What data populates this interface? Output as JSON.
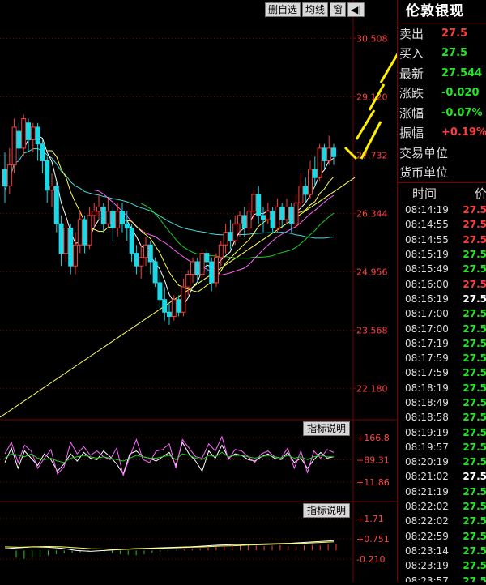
{
  "toolbar": {
    "buttons": [
      "删自选",
      "均线",
      "窗"
    ],
    "arrow_label": "◀|"
  },
  "price_axis": {
    "labels": [
      "30.508",
      "29.120",
      "27.732",
      "26.344",
      "24.956",
      "23.568",
      "22.180"
    ]
  },
  "indicator1": {
    "button": "指标说明",
    "labels": [
      "+166.8",
      "+89.31",
      "+11.86"
    ]
  },
  "indicator2": {
    "button": "指标说明",
    "labels": [
      "+1.71",
      "+0.751",
      "-0.210"
    ]
  },
  "panel": {
    "title": "伦敦银现",
    "quotes": [
      {
        "label": "卖出",
        "value": "27.5",
        "color": "#ff3b3b"
      },
      {
        "label": "买入",
        "value": "27.5",
        "color": "#22e622"
      },
      {
        "label": "最新",
        "value": "27.544",
        "color": "#22e622"
      },
      {
        "label": "涨跌",
        "value": "-0.020",
        "color": "#22e622"
      },
      {
        "label": "涨幅",
        "value": "-0.07%",
        "color": "#22e622"
      },
      {
        "label": "振幅",
        "value": "+0.19%",
        "color": "#ff3b3b"
      },
      {
        "label": "交易单位",
        "value": "",
        "color": "#ddd"
      },
      {
        "label": "货币单位",
        "value": "",
        "color": "#ddd"
      }
    ],
    "ticks_header": {
      "time": "时间",
      "price": "价"
    },
    "ticks": [
      {
        "time": "08:14:19",
        "price": "27.5",
        "color": "#ff3b3b"
      },
      {
        "time": "08:14:55",
        "price": "27.5",
        "color": "#ff3b3b"
      },
      {
        "time": "08:14:55",
        "price": "27.5",
        "color": "#ff3b3b"
      },
      {
        "time": "08:15:19",
        "price": "27.5",
        "color": "#22e622"
      },
      {
        "time": "08:15:49",
        "price": "27.5",
        "color": "#22e622"
      },
      {
        "time": "08:16:00",
        "price": "27.5",
        "color": "#ff3b3b"
      },
      {
        "time": "08:16:19",
        "price": "27.5",
        "color": "#ffffff"
      },
      {
        "time": "08:17:00",
        "price": "27.5",
        "color": "#22e622"
      },
      {
        "time": "08:17:00",
        "price": "27.5",
        "color": "#22e622"
      },
      {
        "time": "08:17:19",
        "price": "27.5",
        "color": "#22e622"
      },
      {
        "time": "08:17:59",
        "price": "27.5",
        "color": "#22e622"
      },
      {
        "time": "08:17:59",
        "price": "27.5",
        "color": "#22e622"
      },
      {
        "time": "08:18:19",
        "price": "27.5",
        "color": "#22e622"
      },
      {
        "time": "08:18:49",
        "price": "27.5",
        "color": "#22e622"
      },
      {
        "time": "08:18:58",
        "price": "27.5",
        "color": "#22e622"
      },
      {
        "time": "08:19:19",
        "price": "27.5",
        "color": "#22e622"
      },
      {
        "time": "08:19:57",
        "price": "27.5",
        "color": "#22e622"
      },
      {
        "time": "08:20:19",
        "price": "27.5",
        "color": "#22e622"
      },
      {
        "time": "08:21:02",
        "price": "27.5",
        "color": "#ffffff"
      },
      {
        "time": "08:21:19",
        "price": "27.5",
        "color": "#22e622"
      },
      {
        "time": "08:22:02",
        "price": "27.5",
        "color": "#22e622"
      },
      {
        "time": "08:22:02",
        "price": "27.5",
        "color": "#22e622"
      },
      {
        "time": "08:22:59",
        "price": "27.5",
        "color": "#22e622"
      },
      {
        "time": "08:23:14",
        "price": "27.5",
        "color": "#22e622"
      },
      {
        "time": "08:23:19",
        "price": "27.5",
        "color": "#22e622"
      },
      {
        "time": "08:23:57",
        "price": "27.5",
        "color": "#22e622"
      }
    ]
  },
  "chart_data": {
    "type": "candlestick",
    "ylim": [
      21.5,
      31.0
    ],
    "colors": {
      "up": "#ff3b3b",
      "down": "#19d9e6",
      "ma5": "#ffffff",
      "ma10": "#ffff55",
      "ma20": "#ff66ff",
      "ma30": "#22cc22",
      "ma60": "#44dddd",
      "trend": "#ffff66",
      "axis": "#7a0000"
    },
    "candles": [
      [
        27.4,
        27.0,
        27.8,
        26.6
      ],
      [
        27.0,
        27.5,
        27.9,
        26.8
      ],
      [
        27.5,
        28.4,
        28.6,
        27.3
      ],
      [
        28.3,
        27.9,
        28.5,
        27.6
      ],
      [
        27.9,
        28.6,
        28.7,
        27.7
      ],
      [
        28.5,
        28.1,
        28.6,
        27.8
      ],
      [
        28.1,
        28.4,
        28.5,
        27.8
      ],
      [
        28.4,
        28.0,
        28.5,
        27.6
      ],
      [
        28.0,
        27.6,
        28.1,
        27.3
      ],
      [
        27.6,
        26.9,
        27.7,
        26.6
      ],
      [
        26.9,
        27.0,
        27.3,
        26.5
      ],
      [
        27.0,
        26.1,
        27.1,
        25.9
      ],
      [
        26.1,
        25.4,
        26.3,
        25.1
      ],
      [
        25.4,
        26.0,
        26.2,
        25.2
      ],
      [
        26.0,
        25.1,
        26.1,
        24.9
      ],
      [
        25.1,
        25.6,
        25.9,
        24.9
      ],
      [
        25.6,
        26.2,
        26.4,
        25.4
      ],
      [
        26.2,
        25.6,
        26.3,
        25.4
      ],
      [
        25.6,
        26.3,
        26.5,
        25.5
      ],
      [
        26.3,
        26.4,
        26.6,
        26.0
      ],
      [
        26.4,
        26.5,
        26.8,
        26.2
      ],
      [
        26.5,
        26.1,
        26.6,
        25.9
      ],
      [
        26.1,
        26.4,
        26.7,
        26.0
      ],
      [
        26.4,
        26.0,
        26.5,
        25.7
      ],
      [
        26.0,
        26.4,
        26.6,
        25.8
      ],
      [
        26.4,
        26.1,
        26.6,
        25.9
      ],
      [
        26.1,
        26.0,
        26.4,
        25.7
      ],
      [
        26.0,
        25.4,
        26.1,
        25.2
      ],
      [
        25.4,
        25.1,
        25.6,
        24.9
      ],
      [
        25.1,
        25.3,
        25.6,
        24.8
      ],
      [
        25.3,
        25.6,
        25.8,
        25.1
      ],
      [
        25.6,
        25.2,
        25.7,
        24.9
      ],
      [
        25.2,
        24.7,
        25.3,
        24.6
      ],
      [
        24.7,
        24.3,
        24.9,
        24.1
      ],
      [
        24.3,
        24.0,
        24.6,
        23.8
      ],
      [
        24.0,
        23.9,
        24.2,
        23.7
      ],
      [
        23.9,
        24.3,
        24.4,
        23.8
      ],
      [
        24.3,
        24.0,
        24.4,
        23.9
      ],
      [
        24.0,
        24.6,
        24.8,
        23.9
      ],
      [
        24.6,
        24.9,
        25.0,
        24.4
      ],
      [
        24.9,
        25.2,
        25.3,
        24.7
      ],
      [
        25.2,
        24.9,
        25.3,
        24.7
      ],
      [
        24.9,
        25.4,
        25.5,
        24.8
      ],
      [
        25.4,
        25.2,
        25.5,
        24.9
      ],
      [
        25.2,
        24.7,
        25.3,
        24.5
      ],
      [
        24.7,
        25.3,
        25.4,
        24.6
      ],
      [
        25.3,
        25.6,
        25.7,
        25.1
      ],
      [
        25.6,
        25.9,
        26.1,
        25.4
      ],
      [
        25.9,
        25.7,
        26.2,
        25.5
      ],
      [
        25.7,
        26.1,
        26.3,
        25.6
      ],
      [
        26.1,
        26.3,
        26.4,
        25.8
      ],
      [
        26.3,
        26.0,
        26.5,
        25.8
      ],
      [
        26.0,
        26.4,
        26.6,
        25.8
      ],
      [
        26.4,
        26.8,
        26.9,
        26.2
      ],
      [
        26.8,
        26.3,
        27.0,
        26.1
      ],
      [
        26.3,
        26.2,
        26.5,
        25.9
      ],
      [
        26.2,
        26.4,
        26.6,
        26.1
      ],
      [
        26.4,
        26.0,
        26.5,
        25.9
      ],
      [
        26.0,
        26.5,
        26.7,
        25.9
      ],
      [
        26.5,
        26.2,
        26.6,
        26.0
      ],
      [
        26.2,
        26.5,
        26.7,
        26.1
      ],
      [
        26.5,
        26.1,
        26.6,
        25.9
      ],
      [
        26.1,
        26.6,
        26.8,
        26.0
      ],
      [
        26.6,
        27.0,
        27.3,
        26.5
      ],
      [
        27.0,
        26.8,
        27.2,
        26.6
      ],
      [
        26.8,
        27.4,
        27.6,
        26.7
      ],
      [
        27.4,
        27.2,
        27.7,
        27.0
      ],
      [
        27.2,
        27.9,
        28.0,
        27.1
      ],
      [
        27.9,
        27.6,
        28.0,
        27.4
      ],
      [
        27.6,
        27.9,
        28.2,
        27.5
      ],
      [
        27.9,
        27.7,
        28.0,
        27.5
      ]
    ],
    "indicator1_series": [
      {
        "name": "k",
        "color": "#ffffff",
        "values": [
          80,
          130,
          60,
          120,
          95,
          70,
          110,
          90,
          50,
          75,
          110,
          85,
          115,
          95,
          90,
          120,
          100,
          75,
          40,
          110,
          120,
          100,
          95,
          85,
          100,
          115,
          70,
          150,
          110,
          85,
          50,
          120,
          95,
          140,
          95,
          110,
          105,
          90,
          85,
          100,
          110,
          95,
          90,
          115,
          80,
          95,
          60,
          90,
          115,
          95,
          100
        ]
      },
      {
        "name": "d",
        "color": "#ff66ff",
        "values": [
          110,
          150,
          80,
          140,
          120,
          60,
          95,
          125,
          40,
          65,
          150,
          110,
          135,
          105,
          120,
          100,
          90,
          130,
          35,
          100,
          160,
          90,
          80,
          120,
          125,
          145,
          60,
          160,
          130,
          100,
          95,
          145,
          120,
          170,
          90,
          125,
          120,
          100,
          80,
          110,
          120,
          100,
          95,
          130,
          60,
          120,
          45,
          120,
          95,
          125,
          115
        ]
      },
      {
        "name": "j",
        "color": "#22cc22",
        "values": [
          95,
          110,
          105,
          100,
          110,
          95,
          90,
          95,
          85,
          80,
          95,
          100,
          105,
          100,
          95,
          100,
          95,
          90,
          85,
          95,
          105,
          100,
          95,
          95,
          100,
          105,
          90,
          110,
          105,
          95,
          90,
          105,
          100,
          115,
          100,
          105,
          105,
          100,
          95,
          100,
          105,
          100,
          95,
          105,
          95,
          100,
          90,
          100,
          105,
          100,
          100
        ]
      }
    ],
    "indicator2_histogram": [
      -0.3,
      -0.35,
      -0.3,
      -0.25,
      -0.2,
      -0.15,
      -0.12,
      -0.1,
      -0.08,
      -0.05,
      -0.04,
      -0.06,
      -0.1,
      -0.15,
      -0.18,
      -0.2,
      -0.15,
      -0.1,
      -0.06,
      -0.03,
      0.02,
      0.05,
      0.08,
      0.1,
      0.12,
      0.14,
      0.16,
      0.18,
      0.2,
      0.22,
      0.2,
      0.18,
      0.2,
      0.22,
      0.18,
      0.16,
      0.2,
      0.22,
      0.2,
      0.24,
      0.26
    ],
    "indicator2_lines": [
      {
        "name": "dif",
        "color": "#ffffff",
        "values": [
          0.1,
          0.15,
          0.2,
          0.18,
          0.12,
          0.0,
          -0.05,
          0.0,
          0.05,
          0.1,
          0.12,
          0.15,
          0.18,
          0.2,
          0.25,
          0.3,
          0.32,
          0.34,
          0.36,
          0.38,
          0.4,
          0.45,
          0.5,
          0.55
        ]
      },
      {
        "name": "dea",
        "color": "#ffff55",
        "values": [
          0.2,
          0.18,
          0.2,
          0.22,
          0.2,
          0.15,
          0.1,
          0.08,
          0.05,
          0.08,
          0.1,
          0.12,
          0.15,
          0.18,
          0.2,
          0.24,
          0.26,
          0.3,
          0.32,
          0.35,
          0.37,
          0.4,
          0.44,
          0.48
        ]
      }
    ]
  }
}
